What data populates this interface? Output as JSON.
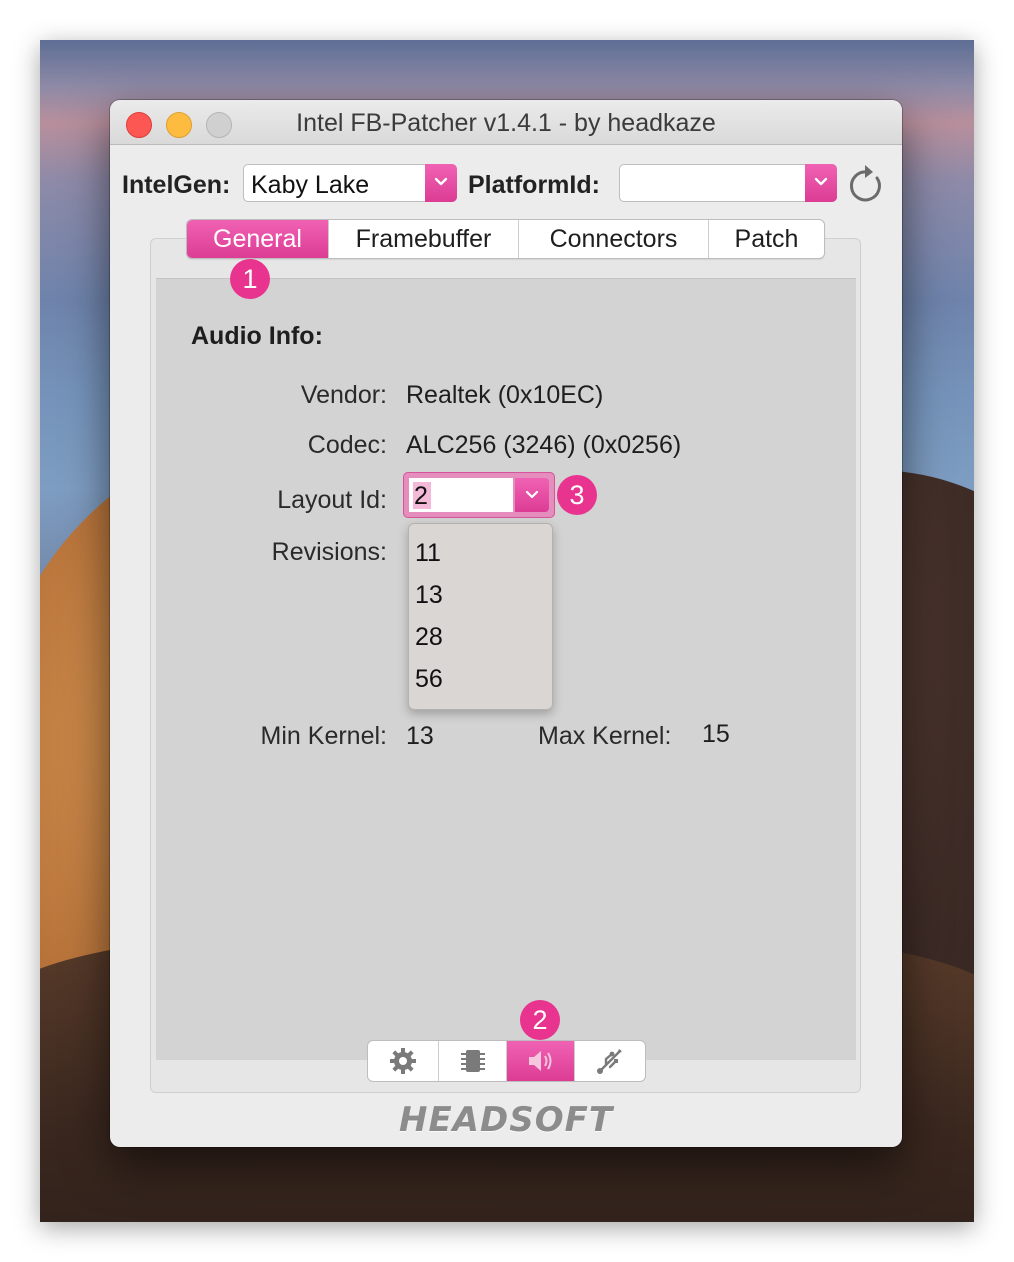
{
  "window": {
    "title": "Intel FB-Patcher v1.4.1 - by headkaze"
  },
  "toolbar": {
    "intelgen_label": "IntelGen:",
    "intelgen_value": "Kaby Lake",
    "platformid_label": "PlatformId:",
    "platformid_value": "",
    "refresh_icon": "refresh-icon"
  },
  "tabs": [
    {
      "label": "General",
      "active": true
    },
    {
      "label": "Framebuffer",
      "active": false
    },
    {
      "label": "Connectors",
      "active": false
    },
    {
      "label": "Patch",
      "active": false
    }
  ],
  "badges": [
    "1",
    "2",
    "3"
  ],
  "audio": {
    "section_title": "Audio Info:",
    "vendor_label": "Vendor:",
    "vendor_value": "Realtek (0x10EC)",
    "codec_label": "Codec:",
    "codec_value": "ALC256 (3246) (0x0256)",
    "layout_label": "Layout Id:",
    "layout_value": "2",
    "revisions_label": "Revisions:",
    "layout_options": [
      "11",
      "13",
      "28",
      "56"
    ],
    "min_kernel_label": "Min Kernel:",
    "min_kernel_value": "13",
    "max_kernel_label": "Max Kernel:",
    "max_kernel_value": "15"
  },
  "bottom_segments": [
    {
      "icon": "gear-icon",
      "active": false
    },
    {
      "icon": "chip-icon",
      "active": false
    },
    {
      "icon": "speaker-icon",
      "active": true
    },
    {
      "icon": "usb-icon",
      "active": false
    }
  ],
  "brand": "HEADSOFT",
  "colors": {
    "accent": "#e8338f",
    "accent_gradient_top": "#f062b4",
    "accent_gradient_bottom": "#dc3c94"
  }
}
